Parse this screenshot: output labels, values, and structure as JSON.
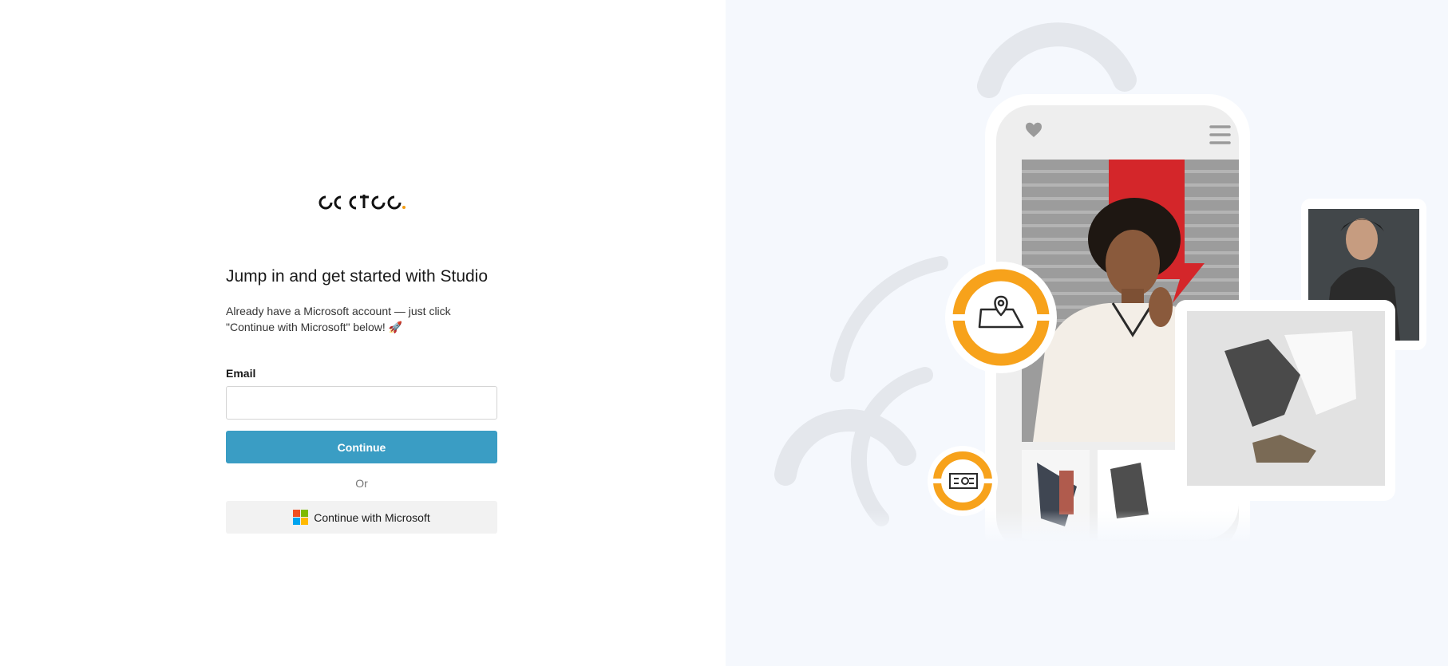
{
  "brand": {
    "logo_text": "occtoo",
    "dot_color": "#f39c12"
  },
  "signin": {
    "title": "Jump in and get started with Studio",
    "intro": "Already have a Microsoft account — just click \"Continue with Microsoft\" below! 🚀",
    "email_label": "Email",
    "email_value": "",
    "email_placeholder": "",
    "continue_label": "Continue",
    "or_label": "Or",
    "microsoft_label": "Continue with Microsoft"
  },
  "colors": {
    "primary": "#3a9dc4",
    "accent_orange": "#f7a21b",
    "microsoft": [
      "#f25022",
      "#7fba00",
      "#00a4ef",
      "#ffb900"
    ]
  },
  "illustration": {
    "icons": [
      "heart-icon",
      "menu-icon",
      "map-pin-icon",
      "cash-icon"
    ]
  }
}
